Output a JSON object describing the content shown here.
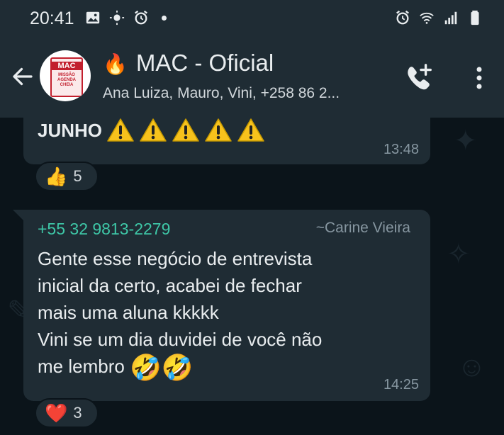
{
  "status_bar": {
    "time": "20:41",
    "left_icons": [
      "image-icon",
      "brightness-icon",
      "alarm-icon",
      "dot-icon"
    ],
    "right_icons": [
      "alarm-icon",
      "wifi-icon",
      "signal-icon",
      "battery-icon"
    ]
  },
  "header": {
    "back_icon": "arrow-back-icon",
    "avatar_lines": [
      "MAC",
      "MISSÃO",
      "AGENDA",
      "CHEIA"
    ],
    "title_emoji": "🔥",
    "title": "MAC - Oficial",
    "subtitle": "Ana Luiza, Mauro, Vini, +258 86 2...",
    "call_icon": "add-call-icon",
    "menu_icon": "more-vert-icon"
  },
  "messages": [
    {
      "text": "JUNHO",
      "emoji_count": 5,
      "emoji": "warning",
      "time": "13:48",
      "reaction": {
        "emoji": "👍",
        "count": "5"
      }
    },
    {
      "sender_phone": "+55 32 9813-2279",
      "sender_name": "~Carine Vieira",
      "lines": [
        "Gente esse negócio de entrevista",
        "inicial da certo, acabei de fechar",
        "mais uma aluna kkkkk",
        "Vini se um dia duvidei de você não",
        "me lembro"
      ],
      "trailing_emoji": "🤣🤣",
      "time": "14:25",
      "reaction": {
        "emoji": "❤️",
        "count": "3"
      }
    }
  ],
  "colors": {
    "background": "#0b141a",
    "bar": "#1f2c34",
    "bubble": "#1f2c34",
    "sender": "#3ec7a7",
    "meta": "#8696a0"
  }
}
